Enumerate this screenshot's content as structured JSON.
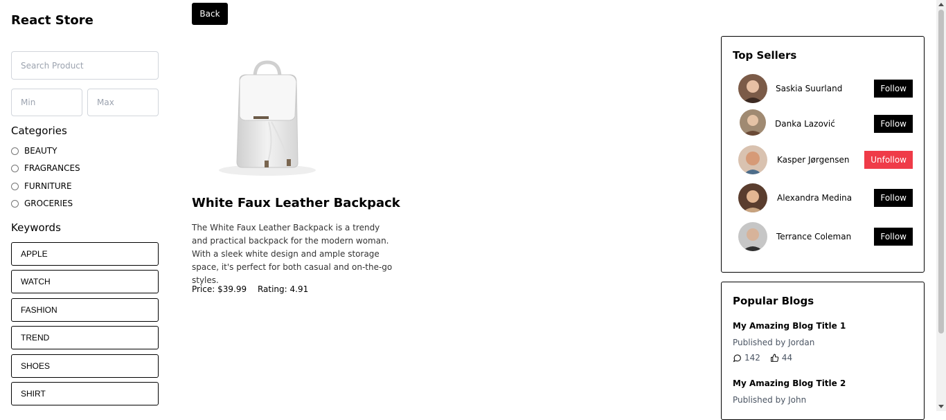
{
  "app": {
    "title": "React Store"
  },
  "filters": {
    "search_placeholder": "Search Product",
    "min_placeholder": "Min",
    "max_placeholder": "Max",
    "categories_heading": "Categories",
    "categories": [
      "BEAUTY",
      "FRAGRANCES",
      "FURNITURE",
      "GROCERIES"
    ],
    "keywords_heading": "Keywords",
    "keywords": [
      "APPLE",
      "WATCH",
      "FASHION",
      "TREND",
      "SHOES",
      "SHIRT"
    ]
  },
  "product": {
    "back_label": "Back",
    "title": "White Faux Leather Backpack",
    "description": "The White Faux Leather Backpack is a trendy and practical backpack for the modern woman. With a sleek white design and ample storage space, it's perfect for both casual and on-the-go styles.",
    "price": "Price: $39.99",
    "rating": "Rating: 4.91"
  },
  "top_sellers": {
    "title": "Top Sellers",
    "items": [
      {
        "name": "Saskia Suurland",
        "action": "Follow",
        "following": false,
        "avatar_color": "#6b4a3a"
      },
      {
        "name": "Danka Lazović",
        "action": "Follow",
        "following": false,
        "avatar_color": "#8a6a52"
      },
      {
        "name": "Kasper Jørgensen",
        "action": "Unfollow",
        "following": true,
        "avatar_color": "#c98b6a"
      },
      {
        "name": "Alexandra Medina",
        "action": "Follow",
        "following": false,
        "avatar_color": "#5a3a2a"
      },
      {
        "name": "Terrance Coleman",
        "action": "Follow",
        "following": false,
        "avatar_color": "#4a4a4a"
      }
    ]
  },
  "popular_blogs": {
    "title": "Popular Blogs",
    "items": [
      {
        "title": "My Amazing Blog Title 1",
        "author": "Published by Jordan",
        "comments": "142",
        "likes": "44"
      },
      {
        "title": "My Amazing Blog Title 2",
        "author": "Published by John",
        "comments": "",
        "likes": ""
      }
    ]
  },
  "colors": {
    "primary": "#000000",
    "unfollow": "#ef3b48"
  }
}
